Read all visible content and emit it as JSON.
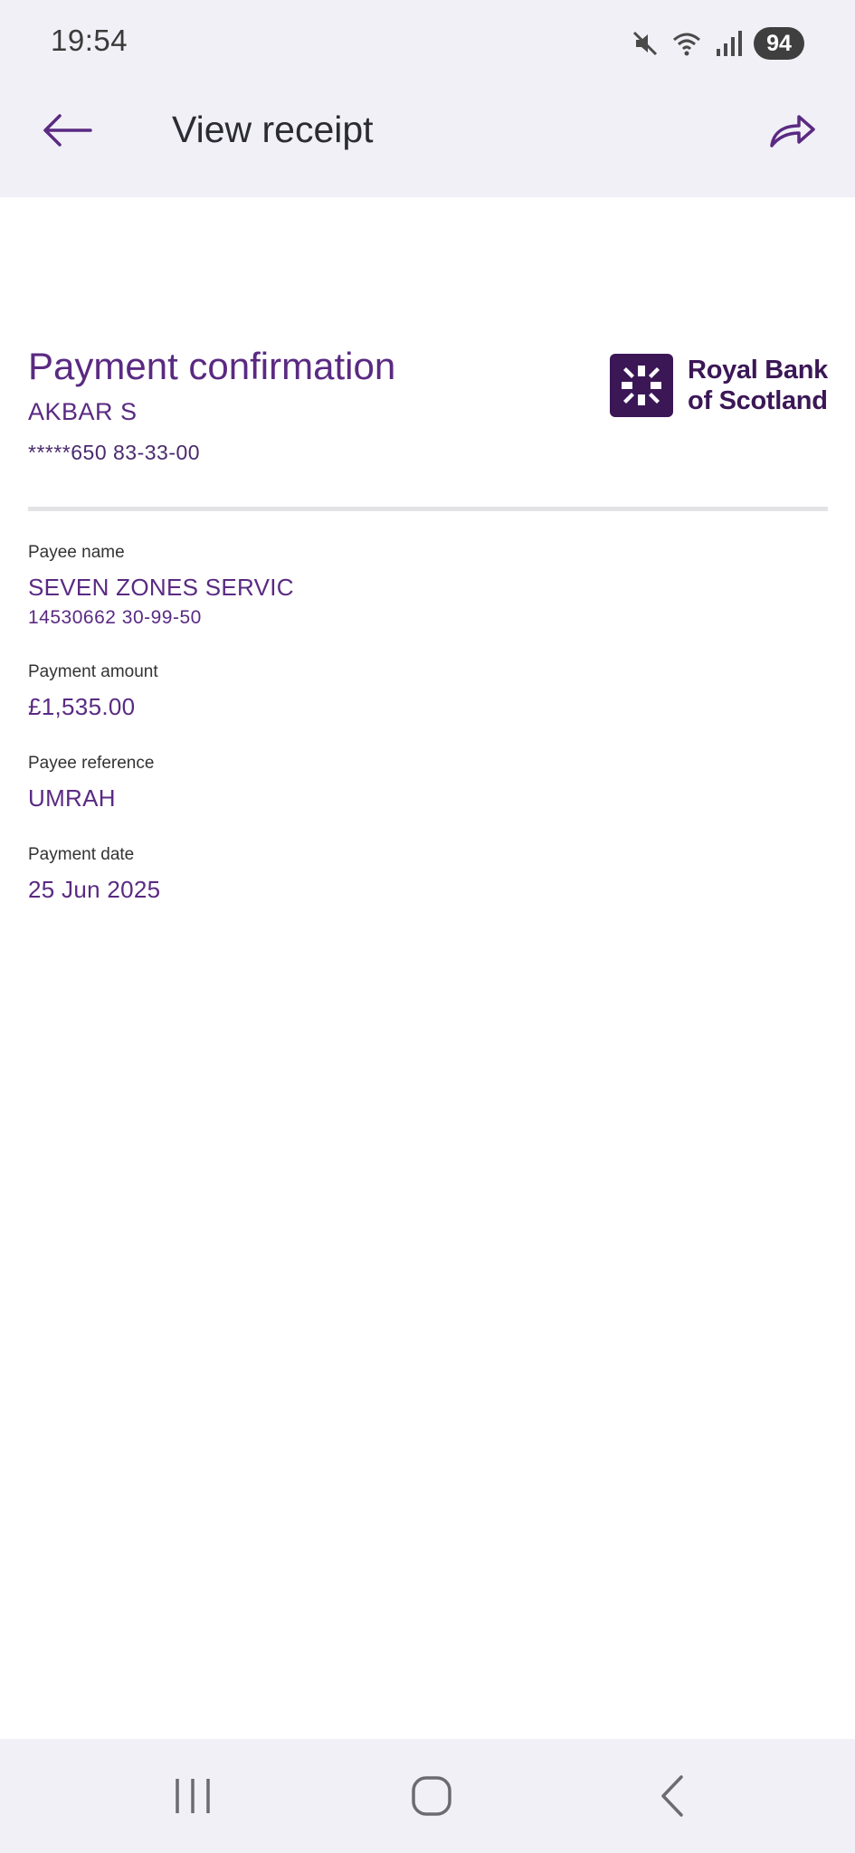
{
  "status_bar": {
    "time": "19:54",
    "icons": [
      "mute-icon",
      "wifi-icon",
      "signal-icon"
    ],
    "battery": "94"
  },
  "app_bar": {
    "title": "View receipt",
    "back_icon": "arrow-left-icon",
    "share_icon": "share-icon"
  },
  "receipt": {
    "title": "Payment confirmation",
    "payer_name": "AKBAR S",
    "payer_account": "*****650 83-33-00",
    "bank_name_line1": "Royal Bank",
    "bank_name_line2": "of Scotland",
    "fields": [
      {
        "label": "Payee name",
        "value": "SEVEN ZONES SERVIC",
        "sub": "14530662 30-99-50"
      },
      {
        "label": "Payment amount",
        "value": "£1,535.00"
      },
      {
        "label": "Payee reference",
        "value": "UMRAH"
      },
      {
        "label": "Payment date",
        "value": "25 Jun 2025"
      }
    ]
  },
  "colors": {
    "accent": "#5a2a82",
    "brand": "#3b1756",
    "chrome_background": "#f1f0f7"
  },
  "nav_bar": {
    "recent_icon": "recent-apps-icon",
    "home_icon": "home-icon",
    "back_icon": "nav-back-icon"
  }
}
